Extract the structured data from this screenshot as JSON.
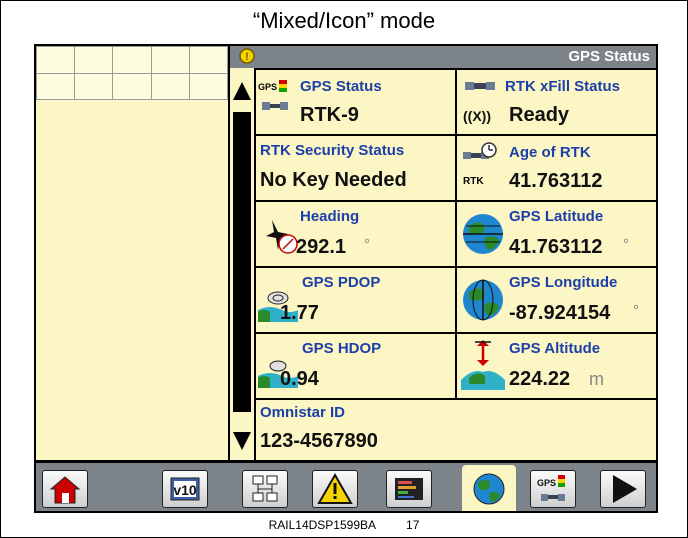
{
  "caption": "“Mixed/Icon” mode",
  "header": {
    "title": "GPS Status"
  },
  "cells": {
    "gps_status": {
      "label": "GPS Status",
      "value": "RTK-9",
      "badge": "GPS"
    },
    "rtk_xfill": {
      "label": "RTK xFill Status",
      "value": "Ready",
      "prefix": "((X))"
    },
    "rtk_security": {
      "label": "RTK Security Status",
      "value": "No Key Needed"
    },
    "age_of_rtk": {
      "label": "Age of RTK",
      "value": "41.763112",
      "badge": "RTK"
    },
    "heading": {
      "label": "Heading",
      "value": "292.1",
      "unit": "°"
    },
    "gps_latitude": {
      "label": "GPS Latitude",
      "value": "41.763112",
      "unit": "°"
    },
    "gps_pdop": {
      "label": "GPS PDOP",
      "value": "1.77"
    },
    "gps_longitude": {
      "label": "GPS Longitude",
      "value": "-87.924154",
      "unit": "°"
    },
    "gps_hdop": {
      "label": "GPS HDOP",
      "value": "0.94"
    },
    "gps_altitude": {
      "label": "GPS Altitude",
      "value": "224.22",
      "unit": "m"
    },
    "omnistar_id": {
      "label": "Omnistar ID",
      "value": "123-4567890"
    }
  },
  "tabbar": {
    "v10_label": "v10",
    "gps_label": "GPS"
  },
  "footer": {
    "ref": "RAIL14DSP1599BA",
    "page": "17"
  },
  "colors": {
    "panel": "#fbf6c4",
    "label": "#1d3faa",
    "bar": "#7d8489",
    "warn": "#f5d200"
  }
}
